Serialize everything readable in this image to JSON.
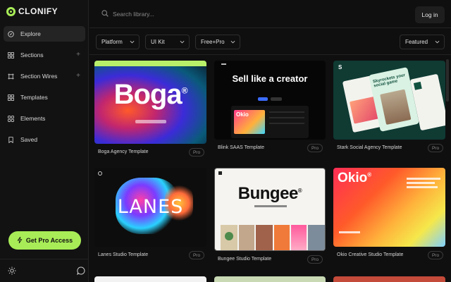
{
  "brand": {
    "name": "CLONIFY",
    "accent": "#a8ed57"
  },
  "sidebar": {
    "items": [
      {
        "label": "Explore",
        "icon": "compass-icon",
        "active": true
      },
      {
        "label": "Sections",
        "icon": "sections-icon",
        "plus": "+"
      },
      {
        "label": "Section Wires",
        "icon": "wires-icon",
        "plus": "+"
      },
      {
        "label": "Templates",
        "icon": "templates-icon"
      },
      {
        "label": "Elements",
        "icon": "elements-icon"
      },
      {
        "label": "Saved",
        "icon": "bookmark-icon"
      }
    ],
    "cta_label": "Get Pro Access",
    "footer_icons": [
      "sun-icon",
      "chat-icon"
    ]
  },
  "header": {
    "search_placeholder": "Search library...",
    "login_label": "Log in"
  },
  "filters": {
    "platform": "Platform",
    "uikit": "UI Kit",
    "pricing": "Free+Pro",
    "sort": "Featured"
  },
  "cards": [
    {
      "title": "Boga Agency Template",
      "badge": "Pro",
      "hero": "Boga",
      "mark": "®"
    },
    {
      "title": "Blink SAAS Template",
      "badge": "Pro",
      "hero": "Sell like a creator",
      "sub": "Okio"
    },
    {
      "title": "Stark Social Agency Template",
      "badge": "Pro",
      "hero": "Skyrockets your social game"
    },
    {
      "title": "Lanes Studio Template",
      "badge": "Pro",
      "hero": "LANES"
    },
    {
      "title": "Bungee Studio Template",
      "badge": "Pro",
      "hero": "Bungee",
      "mark": "®"
    },
    {
      "title": "Okio Creative Studio Template",
      "badge": "Pro",
      "hero": "Okio",
      "mark": "®"
    }
  ]
}
